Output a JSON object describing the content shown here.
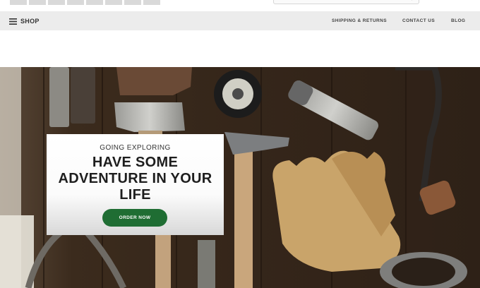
{
  "nav": {
    "shop_label": "SHOP",
    "links": [
      "SHIPPING & RETURNS",
      "CONTACT US",
      "BLOG"
    ]
  },
  "hero": {
    "eyebrow": "GOING EXPLORING",
    "headline": "HAVE SOME ADVENTURE IN YOUR LIFE",
    "cta_label": "ORDER NOW"
  },
  "colors": {
    "nav_bg": "#ececec",
    "cta_green": "#1f6d33",
    "hero_wood": "#3a2a1c"
  }
}
